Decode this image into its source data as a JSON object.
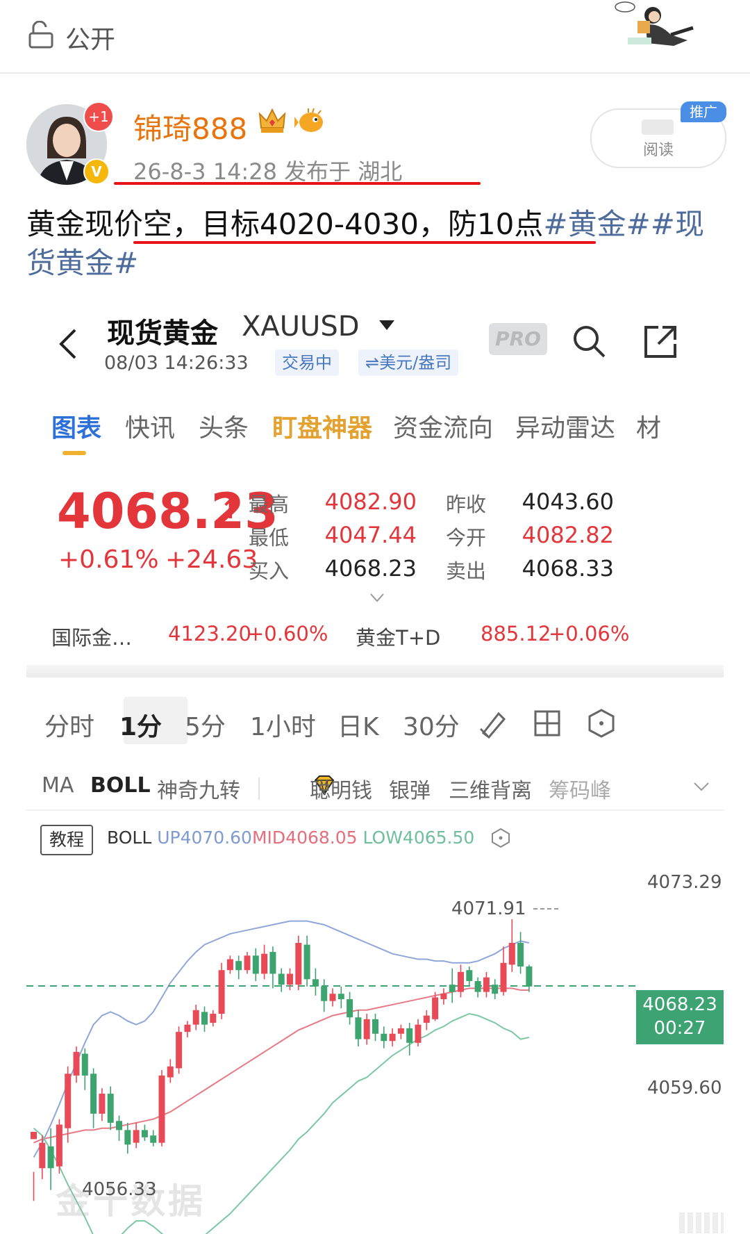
{
  "topbar": {
    "visibility": "公开"
  },
  "post": {
    "username": "锦琦888",
    "notify_badge": "+1",
    "verified_badge": "V",
    "meta": "26-8-3 14:28  发布于 湖北",
    "read_button": "阅读",
    "promo_tag": "推广",
    "text_plain": "黄金现价空，目标4020-4030，防10点",
    "tag1": "#黄金#",
    "tag2": "#现货黄金#"
  },
  "screen": {
    "title": "现货黄金",
    "code": "XAUUSD",
    "timestamp": "08/03 14:26:33",
    "status_chip": "交易中",
    "unit_chip": "⇌美元/盎司",
    "pro_badge": "PRO",
    "tabs": [
      "图表",
      "快讯",
      "头条",
      "盯盘神器",
      "资金流向",
      "异动雷达",
      "材"
    ],
    "price": "4068.23",
    "change_pct": "+0.61%",
    "change_abs": "+24.63",
    "quote": {
      "high_label": "最高",
      "high": "4082.90",
      "low_label": "最低",
      "low": "4047.44",
      "bid_label": "买入",
      "bid": "4068.23",
      "prev_close_label": "昨收",
      "prev_close": "4043.60",
      "open_label": "今开",
      "open": "4082.82",
      "ask_label": "卖出",
      "ask": "4068.33"
    },
    "related": {
      "intl_label": "国际金…",
      "intl_price": "4123.20",
      "intl_pct": "+0.60%",
      "td_label": "黄金T+D",
      "td_price": "885.12",
      "td_pct": "+0.06%"
    },
    "periods": [
      "分时",
      "1分",
      "5分",
      "1小时",
      "日K",
      "30分"
    ],
    "indicators": [
      "MA",
      "BOLL",
      "神奇九转",
      "聪明钱",
      "银弹",
      "三维背离",
      "筹码峰"
    ],
    "tutorial": "教程",
    "boll": {
      "name": "BOLL",
      "up": "UP4070.60",
      "mid": "MID4068.05",
      "low": "LOW4065.50"
    },
    "watermark": "金十数据"
  },
  "chart_data": {
    "type": "candlestick",
    "ylim": [
      4055.0,
      4074.5
    ],
    "y_labels": [
      "4073.29",
      "4059.60"
    ],
    "highest_marker": "4071.91",
    "lowest_marker": "4056.33",
    "current_price": "4068.23",
    "countdown": "00:27",
    "series": [],
    "candles": [
      [
        4059.8,
        4060.2,
        4058.0,
        4056.4
      ],
      [
        4058.2,
        4059.6,
        4060.0,
        4057.6
      ],
      [
        4059.4,
        4058.2,
        4060.4,
        4057.0
      ],
      [
        4058.3,
        4060.6,
        4060.9,
        4057.9
      ],
      [
        4060.4,
        4063.4,
        4063.8,
        4059.6
      ],
      [
        4063.3,
        4064.6,
        4064.9,
        4062.9
      ],
      [
        4064.5,
        4063.3,
        4064.8,
        4062.5
      ],
      [
        4063.4,
        4061.2,
        4063.7,
        4060.4
      ],
      [
        4061.2,
        4062.3,
        4062.6,
        4060.8
      ],
      [
        4062.3,
        4060.7,
        4062.7,
        4060.3
      ],
      [
        4060.8,
        4060.3,
        4061.1,
        4059.7
      ],
      [
        4060.3,
        4059.5,
        4060.7,
        4059.0
      ],
      [
        4059.6,
        4060.3,
        4060.7,
        4059.3
      ],
      [
        4060.3,
        4059.9,
        4060.6,
        4059.7
      ],
      [
        4060.0,
        4059.6,
        4060.3,
        4059.4
      ],
      [
        4059.6,
        4063.3,
        4063.6,
        4059.4
      ],
      [
        4063.2,
        4063.8,
        4064.2,
        4062.9
      ],
      [
        4063.7,
        4065.7,
        4066.0,
        4063.4
      ],
      [
        4065.7,
        4066.1,
        4066.3,
        4065.4
      ],
      [
        4066.1,
        4066.9,
        4067.2,
        4065.8
      ],
      [
        4066.8,
        4066.1,
        4067.1,
        4065.7
      ],
      [
        4066.2,
        4066.7,
        4066.9,
        4066.0
      ],
      [
        4066.7,
        4069.1,
        4069.5,
        4066.4
      ],
      [
        4069.1,
        4069.7,
        4069.9,
        4068.9
      ],
      [
        4069.6,
        4069.1,
        4069.9,
        4068.6
      ],
      [
        4069.1,
        4069.9,
        4070.1,
        4068.9
      ],
      [
        4069.9,
        4068.9,
        4070.3,
        4068.5
      ],
      [
        4068.9,
        4070.0,
        4070.5,
        4068.6
      ],
      [
        4070.1,
        4068.9,
        4070.4,
        4068.1
      ],
      [
        4068.9,
        4068.3,
        4069.2,
        4067.9
      ],
      [
        4068.3,
        4068.9,
        4069.2,
        4068.0
      ],
      [
        4068.3,
        4070.6,
        4071.0,
        4068.0
      ],
      [
        4070.5,
        4068.6,
        4071.0,
        4068.2
      ],
      [
        4068.6,
        4068.2,
        4069.2,
        4067.7
      ],
      [
        4068.2,
        4067.4,
        4068.6,
        4066.8
      ],
      [
        4067.4,
        4067.8,
        4068.1,
        4067.1
      ],
      [
        4067.8,
        4067.5,
        4068.2,
        4067.0
      ],
      [
        4067.5,
        4066.5,
        4067.9,
        4066.1
      ],
      [
        4066.5,
        4065.3,
        4066.9,
        4064.9
      ],
      [
        4065.3,
        4066.4,
        4066.7,
        4065.0
      ],
      [
        4066.4,
        4065.6,
        4066.7,
        4065.2
      ],
      [
        4065.6,
        4065.2,
        4066.0,
        4064.8
      ],
      [
        4065.2,
        4065.6,
        4065.9,
        4064.9
      ],
      [
        4065.6,
        4065.9,
        4066.1,
        4065.3
      ],
      [
        4065.9,
        4065.1,
        4066.2,
        4064.4
      ],
      [
        4065.1,
        4066.1,
        4066.4,
        4064.9
      ],
      [
        4066.2,
        4066.6,
        4066.9,
        4065.8
      ],
      [
        4066.4,
        4067.6,
        4067.9,
        4066.3
      ],
      [
        4067.5,
        4067.8,
        4068.1,
        4067.2
      ],
      [
        4068.3,
        4067.9,
        4069.2,
        4067.3
      ],
      [
        4067.9,
        4069.0,
        4069.4,
        4067.6
      ],
      [
        4069.1,
        4068.5,
        4069.3,
        4068.2
      ],
      [
        4068.5,
        4067.9,
        4068.7,
        4067.6
      ],
      [
        4067.9,
        4068.7,
        4069.0,
        4067.6
      ],
      [
        4068.3,
        4067.8,
        4068.6,
        4067.5
      ],
      [
        4067.9,
        4069.5,
        4070.4,
        4067.7
      ],
      [
        4069.4,
        4070.6,
        4071.9,
        4069.0
      ],
      [
        4070.6,
        4069.3,
        4071.2,
        4068.9
      ],
      [
        4069.3,
        4068.2,
        4069.4,
        4067.9
      ]
    ],
    "boll_up": [
      4058.8,
      4059.6,
      4060.6,
      4061.7,
      4062.9,
      4064.0,
      4065.1,
      4066.1,
      4066.6,
      4066.8,
      4066.6,
      4066.3,
      4066.1,
      4066.3,
      4066.8,
      4067.6,
      4068.4,
      4069.0,
      4069.6,
      4070.1,
      4070.5,
      4070.7,
      4070.9,
      4071.1,
      4071.2,
      4071.3,
      4071.4,
      4071.5,
      4071.6,
      4071.7,
      4071.8,
      4071.8,
      4071.8,
      4071.7,
      4071.6,
      4071.4,
      4071.2,
      4071.0,
      4070.8,
      4070.6,
      4070.4,
      4070.2,
      4070.0,
      4069.9,
      4069.8,
      4069.7,
      4069.7,
      4069.6,
      4069.6,
      4069.5,
      4069.5,
      4069.5,
      4069.6,
      4069.8,
      4070.0,
      4070.3,
      4070.5,
      4070.7,
      4070.6
    ],
    "boll_mid": [
      4059.6,
      4059.8,
      4059.9,
      4060.0,
      4060.1,
      4060.2,
      4060.3,
      4060.3,
      4060.4,
      4060.4,
      4060.5,
      4060.6,
      4060.7,
      4060.8,
      4060.9,
      4061.1,
      4061.3,
      4061.6,
      4061.9,
      4062.2,
      4062.5,
      4062.8,
      4063.1,
      4063.4,
      4063.7,
      4064.0,
      4064.3,
      4064.6,
      4064.9,
      4065.2,
      4065.5,
      4065.8,
      4066.0,
      4066.2,
      4066.4,
      4066.6,
      4066.7,
      4066.8,
      4066.9,
      4066.9,
      4067.0,
      4067.1,
      4067.2,
      4067.3,
      4067.4,
      4067.5,
      4067.6,
      4067.7,
      4067.8,
      4067.9,
      4068.0,
      4068.1,
      4068.1,
      4068.1,
      4068.1,
      4068.1,
      4068.1,
      4068.0,
      4068.0
    ]
  }
}
